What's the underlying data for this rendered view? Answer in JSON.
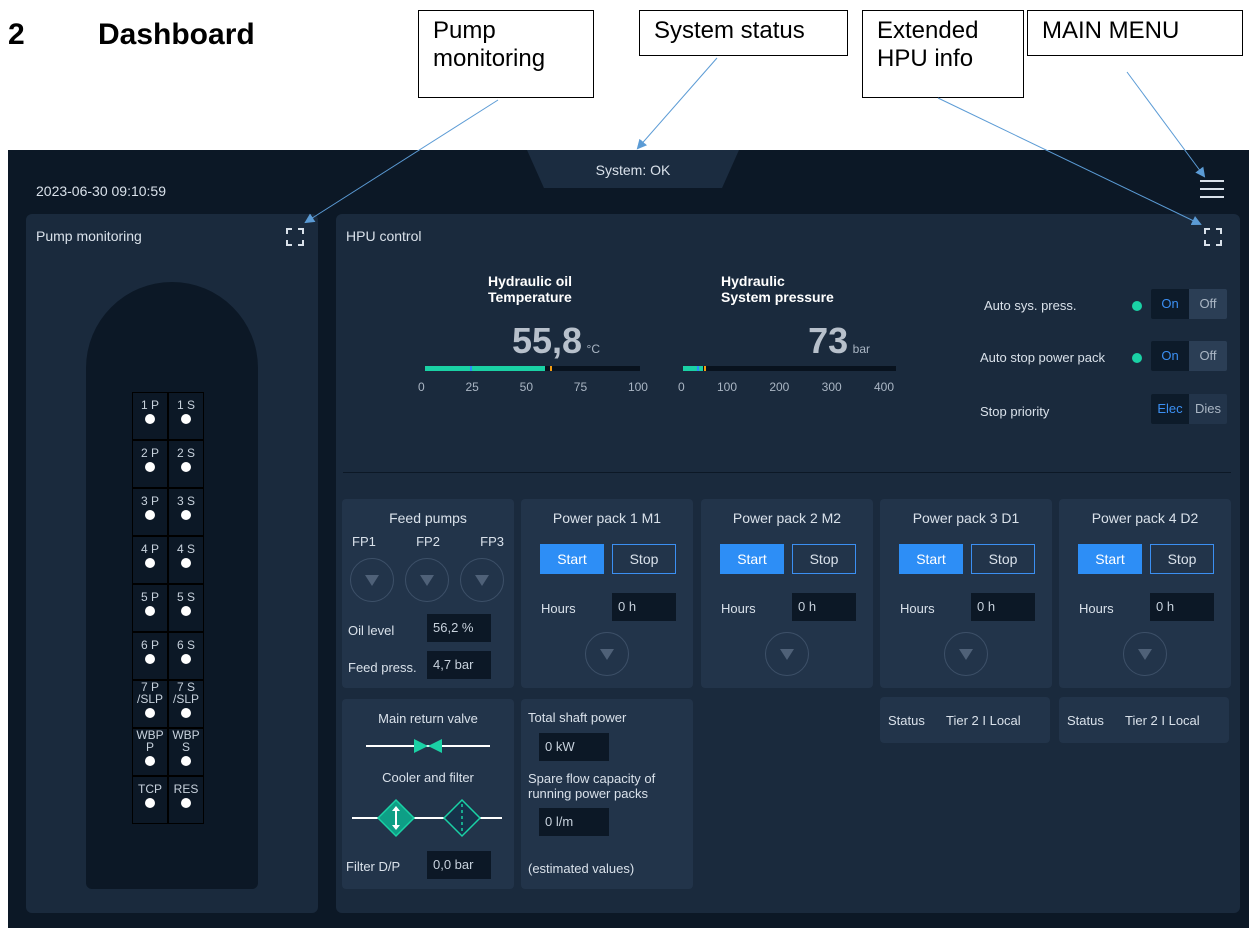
{
  "doc": {
    "section_number": "2",
    "section_title": "Dashboard"
  },
  "callouts": {
    "pump_monitoring_l1": "Pump",
    "pump_monitoring_l2": "monitoring",
    "system_status": "System status",
    "extended_hpu_l1": "Extended",
    "extended_hpu_l2": "HPU info",
    "main_menu": "MAIN MENU"
  },
  "header": {
    "status_text": "System: OK",
    "datetime": "2023-06-30 09:10:59",
    "menu_icon": "hamburger-menu-icon"
  },
  "pump_panel": {
    "title": "Pump monitoring",
    "pumps": [
      [
        "1 P",
        "1 S"
      ],
      [
        "2 P",
        "2 S"
      ],
      [
        "3 P",
        "3 S"
      ],
      [
        "4 P",
        "4 S"
      ],
      [
        "5 P",
        "5 S"
      ],
      [
        "6 P",
        "6 S"
      ],
      [
        "7 P",
        "7 S"
      ],
      [
        "WBP",
        "WBP"
      ],
      [
        "TCP",
        "RES"
      ]
    ],
    "pump_sub": {
      "p7l": "/SLP",
      "s7l": "/SLP",
      "wbpp": "P",
      "wbps": "S"
    }
  },
  "hpu": {
    "title": "HPU control",
    "temp": {
      "title_l1": "Hydraulic oil",
      "title_l2": "Temperature",
      "value": "55,8",
      "unit": "°C",
      "level": 0.558,
      "ticks": [
        "0",
        "25",
        "50",
        "75",
        "100"
      ]
    },
    "pressure": {
      "title_l1": "Hydraulic",
      "title_l2": "System pressure",
      "value": "73",
      "unit": "bar",
      "level": 0.0925,
      "ticks": [
        "0",
        "100",
        "200",
        "300",
        "400"
      ]
    },
    "auto_sys_press": {
      "label": "Auto sys. press.",
      "on": "On",
      "off": "Off"
    },
    "auto_stop": {
      "label": "Auto stop power pack",
      "on": "On",
      "off": "Off"
    },
    "stop_priority": {
      "label": "Stop priority",
      "a": "Elec",
      "b": "Dies"
    }
  },
  "feed": {
    "title": "Feed pumps",
    "fp": [
      "FP1",
      "FP2",
      "FP3"
    ],
    "oil_level_label": "Oil level",
    "oil_level": "56,2 %",
    "feed_press_label": "Feed press.",
    "feed_press": "4,7 bar"
  },
  "power_packs": [
    {
      "title": "Power pack 1 M1",
      "start": "Start",
      "stop": "Stop",
      "hours_label": "Hours",
      "hours": "0 h"
    },
    {
      "title": "Power pack 2 M2",
      "start": "Start",
      "stop": "Stop",
      "hours_label": "Hours",
      "hours": "0 h"
    },
    {
      "title": "Power pack 3 D1",
      "start": "Start",
      "stop": "Stop",
      "hours_label": "Hours",
      "hours": "0 h",
      "status_label": "Status",
      "status": "Tier 2 I Local"
    },
    {
      "title": "Power pack 4 D2",
      "start": "Start",
      "stop": "Stop",
      "hours_label": "Hours",
      "hours": "0 h",
      "status_label": "Status",
      "status": "Tier 2 I Local"
    }
  ],
  "return_panel": {
    "valve_label": "Main return valve",
    "cooler_label": "Cooler and filter",
    "filter_label": "Filter D/P",
    "filter_value": "0,0 bar"
  },
  "shaft_panel": {
    "title": "Total shaft power",
    "value": "0 kW",
    "spare_l1": "Spare flow capacity of",
    "spare_l2": "running power packs",
    "spare_value": "0 l/m",
    "note": "(estimated values)"
  },
  "colors": {
    "accent": "#2d8ef6",
    "green": "#1ad1a5",
    "orange": "#f39c12",
    "bg": "#0c1826",
    "panel": "#1a2a3d"
  }
}
